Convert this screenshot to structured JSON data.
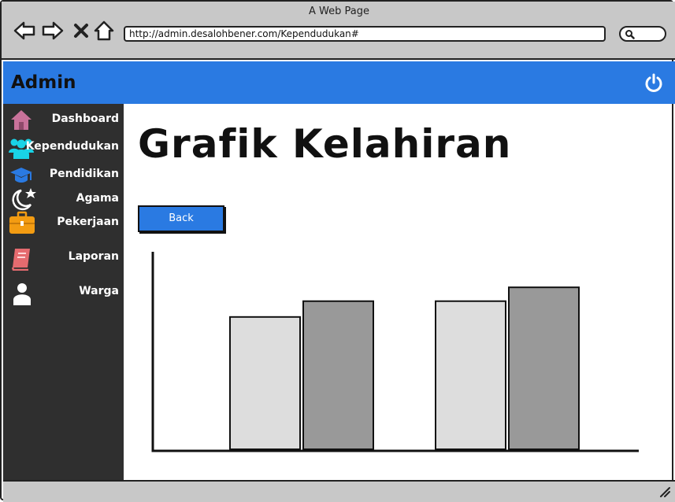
{
  "window": {
    "title": "A Web Page"
  },
  "address_bar": {
    "url": "http://admin.desalohbener.com/Kependudukan#"
  },
  "header": {
    "brand": "Admin"
  },
  "sidebar": {
    "items": [
      {
        "label": "Dashboard",
        "icon": "home-icon",
        "color": "#c9729a"
      },
      {
        "label": "Kependudukan",
        "icon": "users-icon",
        "color": "#19d3e6"
      },
      {
        "label": "Pendidikan",
        "icon": "graduation-cap-icon",
        "color": "#2a7ae2"
      },
      {
        "label": "Agama",
        "icon": "moon-star-icon",
        "color": "#ffffff"
      },
      {
        "label": "Pekerjaan",
        "icon": "briefcase-icon",
        "color": "#f39c12"
      },
      {
        "label": "Laporan",
        "icon": "book-icon",
        "color": "#e56b6f"
      },
      {
        "label": "Warga",
        "icon": "user-icon",
        "color": "#ffffff"
      }
    ]
  },
  "main": {
    "title": "Grafik Kelahiran",
    "back_label": "Back"
  },
  "colors": {
    "accent": "#2a7ae2",
    "sidebar_bg": "#2f2f2f",
    "chrome_bg": "#c8c8c8"
  },
  "chart_data": {
    "type": "bar",
    "categories": [
      "",
      ""
    ],
    "series": [
      {
        "values": [
          67,
          75
        ],
        "color": "#dddddd"
      },
      {
        "values": [
          75,
          82
        ],
        "color": "#999999"
      }
    ],
    "ylim": [
      0,
      100
    ],
    "grid": false,
    "legend": "none",
    "title": "",
    "xlabel": "",
    "ylabel": ""
  }
}
